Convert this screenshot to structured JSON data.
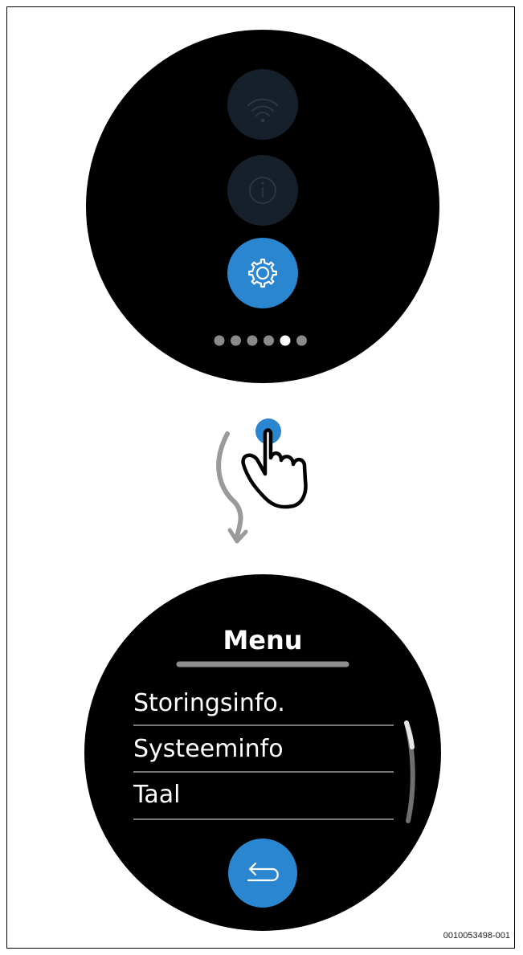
{
  "top_screen": {
    "icons": [
      "wifi-icon",
      "info-icon",
      "gear-icon"
    ],
    "selected_icon": "gear-icon",
    "page_indicator": {
      "total": 6,
      "active": 5
    }
  },
  "gesture": {
    "icons": [
      "hand-tap-icon",
      "swipe-down-arrow-icon"
    ]
  },
  "menu_screen": {
    "title": "Menu",
    "items": [
      "Storingsinfo.",
      "Systeeminfo",
      "Taal"
    ],
    "back_icon": "back-arrow-icon"
  },
  "document_id": "0010053498-001",
  "colors": {
    "screen": "#000000",
    "accent": "#2a86d1",
    "inactive_button": "#16202a",
    "divider": "#a0a0a0",
    "arrow": "#9a9a9a"
  }
}
